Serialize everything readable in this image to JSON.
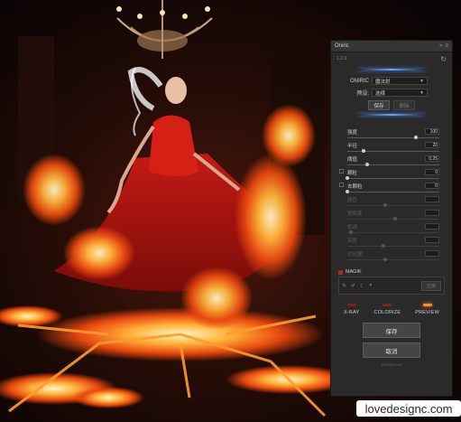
{
  "panel": {
    "title": "Oniric",
    "version": "1.2.0",
    "effect_label": "ONIRIC",
    "effect_value": "魔法射",
    "preset_label": "预设:",
    "preset_value": "选择",
    "save_preset": "保存",
    "delete_preset": "删除",
    "sliders": [
      {
        "label": "强度",
        "value": "100",
        "enabled": true,
        "fill": 0.86
      },
      {
        "label": "半径",
        "value": "20",
        "enabled": true,
        "fill": 0.2
      },
      {
        "label": "阈值",
        "value": "0.25",
        "enabled": true,
        "fill": 0.25
      },
      {
        "label": "颗粒",
        "value": "0",
        "enabled": true,
        "fill": 0.0,
        "checkbox": true
      },
      {
        "label": "去颗粒",
        "value": "0",
        "enabled": true,
        "fill": 0.0,
        "checkbox": true
      },
      {
        "label": "颜色",
        "value": "",
        "enabled": false,
        "fill": 0.48
      },
      {
        "label": "饱和度",
        "value": "",
        "enabled": false,
        "fill": 0.6
      },
      {
        "label": "色调",
        "value": "",
        "enabled": false,
        "fill": 0.05
      },
      {
        "label": "亮度",
        "value": "",
        "enabled": false,
        "fill": 0.45
      },
      {
        "label": "对比度",
        "value": "",
        "enabled": false,
        "fill": 0.48
      }
    ],
    "magic_label": "MAGIK",
    "magic_button": "应用",
    "modes": [
      {
        "label": "X-RAY",
        "active": false
      },
      {
        "label": "COLORIZE",
        "active": false
      },
      {
        "label": "PREVIEW",
        "active": true
      }
    ],
    "ok_button": "保存",
    "cancel_button": "取消",
    "footer": "SOMNIUM"
  },
  "watermark": "lovedesignc.com",
  "colors": {
    "accent_blue": "#6aa2ff",
    "preview_on": "#ff8a2a",
    "panel_bg": "#2a2a2a"
  }
}
